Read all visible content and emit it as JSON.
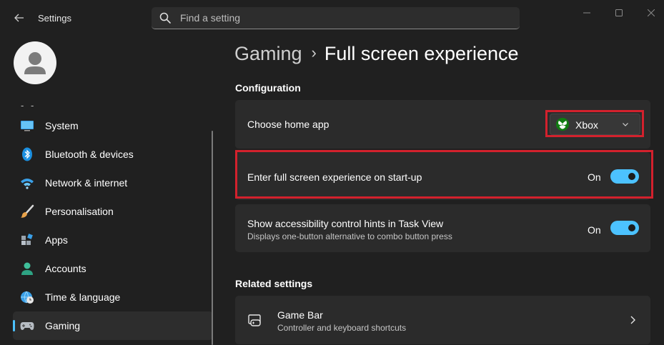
{
  "window": {
    "title": "Settings"
  },
  "search": {
    "placeholder": "Find a setting"
  },
  "sidebar": {
    "items": [
      {
        "label": "System",
        "icon": "monitor-icon"
      },
      {
        "label": "Bluetooth & devices",
        "icon": "bluetooth-icon"
      },
      {
        "label": "Network & internet",
        "icon": "wifi-icon"
      },
      {
        "label": "Personalisation",
        "icon": "brush-icon"
      },
      {
        "label": "Apps",
        "icon": "apps-icon"
      },
      {
        "label": "Accounts",
        "icon": "person-icon"
      },
      {
        "label": "Time & language",
        "icon": "globe-clock-icon"
      },
      {
        "label": "Gaming",
        "icon": "gamepad-icon",
        "active": true
      }
    ]
  },
  "breadcrumb": {
    "parent": "Gaming",
    "separator": "›",
    "current": "Full screen experience"
  },
  "configuration": {
    "title": "Configuration",
    "home_app": {
      "label": "Choose home app",
      "value": "Xbox"
    },
    "fullscreen_startup": {
      "label": "Enter full screen experience on start-up",
      "state": "On"
    },
    "accessibility_hints": {
      "label": "Show accessibility control hints in Task View",
      "description": "Displays one-button alternative to combo button press",
      "state": "On"
    }
  },
  "related": {
    "title": "Related settings",
    "game_bar": {
      "label": "Game Bar",
      "description": "Controller and keyboard shortcuts"
    }
  },
  "colors": {
    "accent": "#4cc2ff",
    "highlight": "#d3212d",
    "xbox": "#107c10",
    "background": "#202020",
    "card": "#2b2b2b"
  }
}
